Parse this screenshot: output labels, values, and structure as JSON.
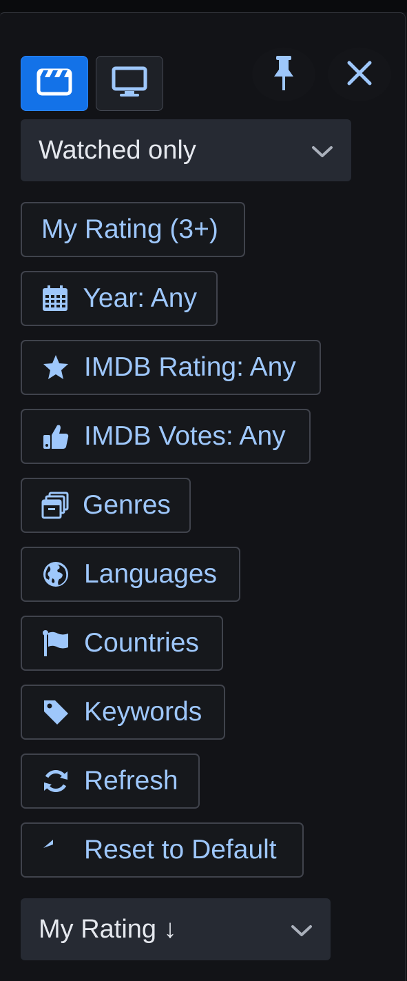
{
  "mode_buttons": {
    "movies_icon": "clapperboard-icon",
    "tv_icon": "monitor-icon"
  },
  "header_actions": {
    "pin_icon": "pin-icon",
    "close_icon": "close-icon"
  },
  "watch_filter": {
    "selected": "Watched only"
  },
  "filters": {
    "my_rating": "My Rating (3+)",
    "year": "Year: Any",
    "imdb_rating": "IMDB Rating: Any",
    "imdb_votes": "IMDB Votes: Any",
    "genres": "Genres",
    "languages": "Languages",
    "countries": "Countries",
    "keywords": "Keywords",
    "refresh": "Refresh",
    "reset": "Reset to Default"
  },
  "sort": {
    "selected": "My Rating ↓"
  },
  "colors": {
    "accent": "#1372e8",
    "button_text": "#9ec7fb",
    "panel_bg": "#121317",
    "select_bg": "#262a33"
  }
}
